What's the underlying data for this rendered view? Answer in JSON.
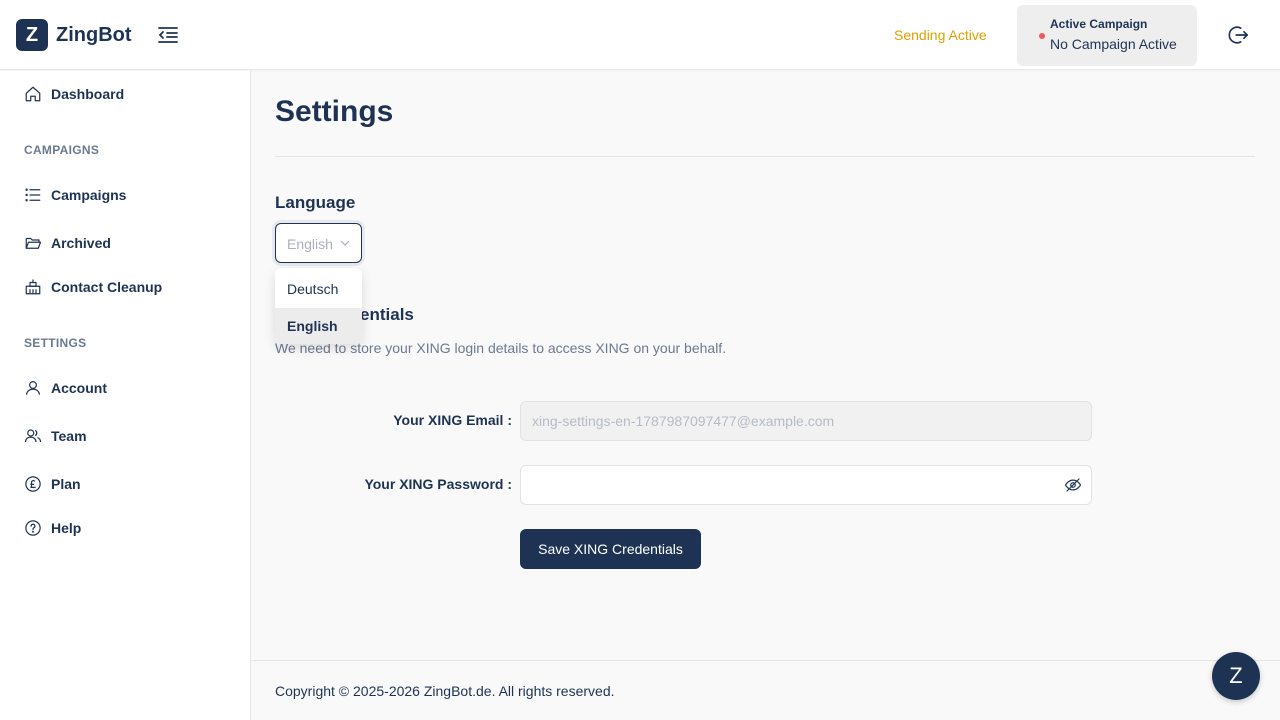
{
  "header": {
    "logo_letter": "Z",
    "app_name": "ZingBot",
    "sending_status": "Sending Active",
    "campaign_label": "Active Campaign",
    "campaign_value": "No Campaign Active"
  },
  "sidebar": {
    "dashboard": "Dashboard",
    "campaigns_section": "CAMPAIGNS",
    "campaigns": "Campaigns",
    "archived": "Archived",
    "contact_cleanup": "Contact Cleanup",
    "settings_section": "SETTINGS",
    "account": "Account",
    "team": "Team",
    "plan": "Plan",
    "help": "Help"
  },
  "main": {
    "title": "Settings",
    "language_heading": "Language",
    "language_value": "English",
    "language_options": [
      "Deutsch",
      "English"
    ],
    "cred_heading": "XING Credentials",
    "cred_description": "We need to store your XING login details to access XING on your behalf.",
    "email_label": "Your XING Email :",
    "email_value": "xing-settings-en-1787987097477@example.com",
    "password_label": "Your XING Password :",
    "password_value": "",
    "save_button": "Save XING Credentials"
  },
  "footer": {
    "copyright": "Copyright © 2025-2026 ZingBot.de. All rights reserved."
  },
  "chat": {
    "letter": "Z"
  },
  "colors": {
    "primary": "#1e3354",
    "sending": "#e0a000",
    "status_dot": "#ef5a5a"
  }
}
